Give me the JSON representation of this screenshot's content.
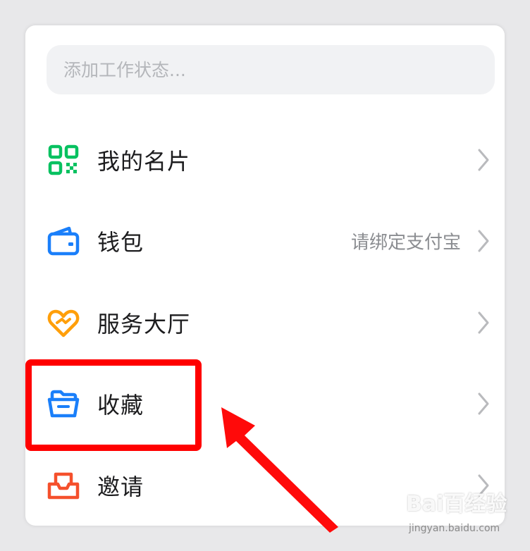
{
  "status": {
    "placeholder": "添加工作状态..."
  },
  "menu": [
    {
      "label": "我的名片",
      "value": "",
      "icon": "qr-code-icon",
      "color": "#07c160"
    },
    {
      "label": "钱包",
      "value": "请绑定支付宝",
      "icon": "wallet-icon",
      "color": "#1a7ffa"
    },
    {
      "label": "服务大厅",
      "value": "",
      "icon": "heart-service-icon",
      "color": "#ff9f0a"
    },
    {
      "label": "收藏",
      "value": "",
      "icon": "folder-icon",
      "color": "#1a7ffa"
    },
    {
      "label": "邀请",
      "value": "",
      "icon": "inbox-icon",
      "color": "#f5502c"
    }
  ],
  "annotation": {
    "highlight_color": "#ff0000"
  },
  "watermark": {
    "logo": "Bai百经验",
    "url": "jingyan.baidu.com"
  }
}
